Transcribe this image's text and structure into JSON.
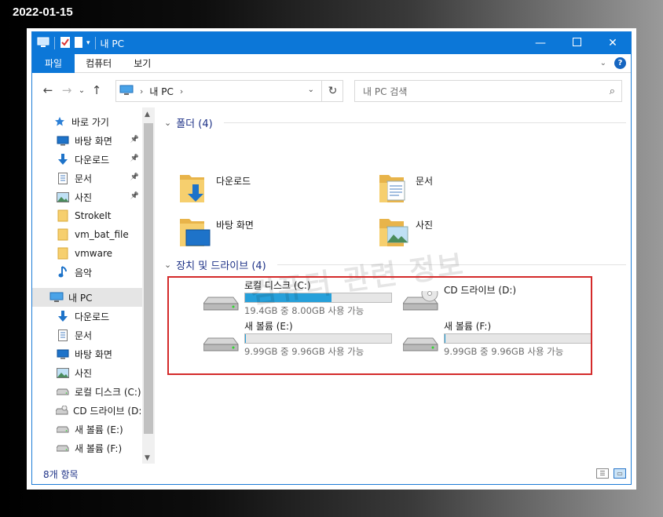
{
  "date_stamp": "2022-01-15",
  "window": {
    "title": "내 PC",
    "ribbon_tabs": [
      "파일",
      "컴퓨터",
      "보기"
    ],
    "help": "?"
  },
  "address": {
    "crumb": "내 PC",
    "search_placeholder": "내 PC 검색"
  },
  "sidebar": {
    "items": [
      {
        "label": "바로 가기",
        "icon": "star-icon",
        "pinned": false
      },
      {
        "label": "바탕 화면",
        "icon": "desktop-icon",
        "pinned": true
      },
      {
        "label": "다운로드",
        "icon": "download-arrow-icon",
        "pinned": true
      },
      {
        "label": "문서",
        "icon": "document-icon",
        "pinned": true
      },
      {
        "label": "사진",
        "icon": "picture-icon",
        "pinned": true
      },
      {
        "label": "StrokeIt",
        "icon": "folder-icon",
        "pinned": false
      },
      {
        "label": "vm_bat_file",
        "icon": "folder-icon",
        "pinned": false
      },
      {
        "label": "vmware",
        "icon": "folder-icon",
        "pinned": false
      },
      {
        "label": "음악",
        "icon": "music-note-icon",
        "pinned": false
      },
      {
        "label": "내 PC",
        "icon": "computer-icon",
        "pinned": false
      },
      {
        "label": "다운로드",
        "icon": "download-arrow-icon",
        "pinned": false
      },
      {
        "label": "문서",
        "icon": "document-icon",
        "pinned": false
      },
      {
        "label": "바탕 화면",
        "icon": "desktop-icon",
        "pinned": false
      },
      {
        "label": "사진",
        "icon": "picture-icon",
        "pinned": false
      },
      {
        "label": "로컬 디스크 (C:)",
        "icon": "drive-icon",
        "pinned": false
      },
      {
        "label": "CD 드라이브 (D:)",
        "icon": "cd-drive-icon",
        "pinned": false
      },
      {
        "label": "새 볼륨 (E:)",
        "icon": "drive-icon",
        "pinned": false
      },
      {
        "label": "새 볼륨 (F:)",
        "icon": "drive-icon",
        "pinned": false
      }
    ]
  },
  "folders": {
    "header": "폴더 (4)",
    "items": [
      {
        "label": "다운로드",
        "icon": "downloads-folder-icon"
      },
      {
        "label": "문서",
        "icon": "documents-folder-icon"
      },
      {
        "label": "바탕 화면",
        "icon": "desktop-folder-icon"
      },
      {
        "label": "사진",
        "icon": "pictures-folder-icon"
      }
    ]
  },
  "drives": {
    "header": "장치 및 드라이브 (4)",
    "items": [
      {
        "name": "로컬 디스크 (C:)",
        "info": "19.4GB 중 8.00GB 사용 가능",
        "used_fraction": 0.59,
        "icon": "hard-drive-icon"
      },
      {
        "name": "CD 드라이브 (D:)",
        "info": "",
        "used_fraction": null,
        "icon": "cd-drive-icon"
      },
      {
        "name": "새 볼륨 (E:)",
        "info": "9.99GB 중 9.96GB 사용 가능",
        "used_fraction": 0.003,
        "icon": "hard-drive-icon"
      },
      {
        "name": "새 볼륨 (F:)",
        "info": "9.99GB 중 9.96GB 사용 가능",
        "used_fraction": 0.003,
        "icon": "hard-drive-icon"
      }
    ]
  },
  "watermark": "컴퓨터 관련 정보",
  "status": {
    "count": "8개 항목"
  },
  "colors": {
    "accent": "#0c77d8",
    "drive_fill": "#26a0da",
    "highlight": "#d42a2a",
    "selection": "#e5e5e5"
  }
}
